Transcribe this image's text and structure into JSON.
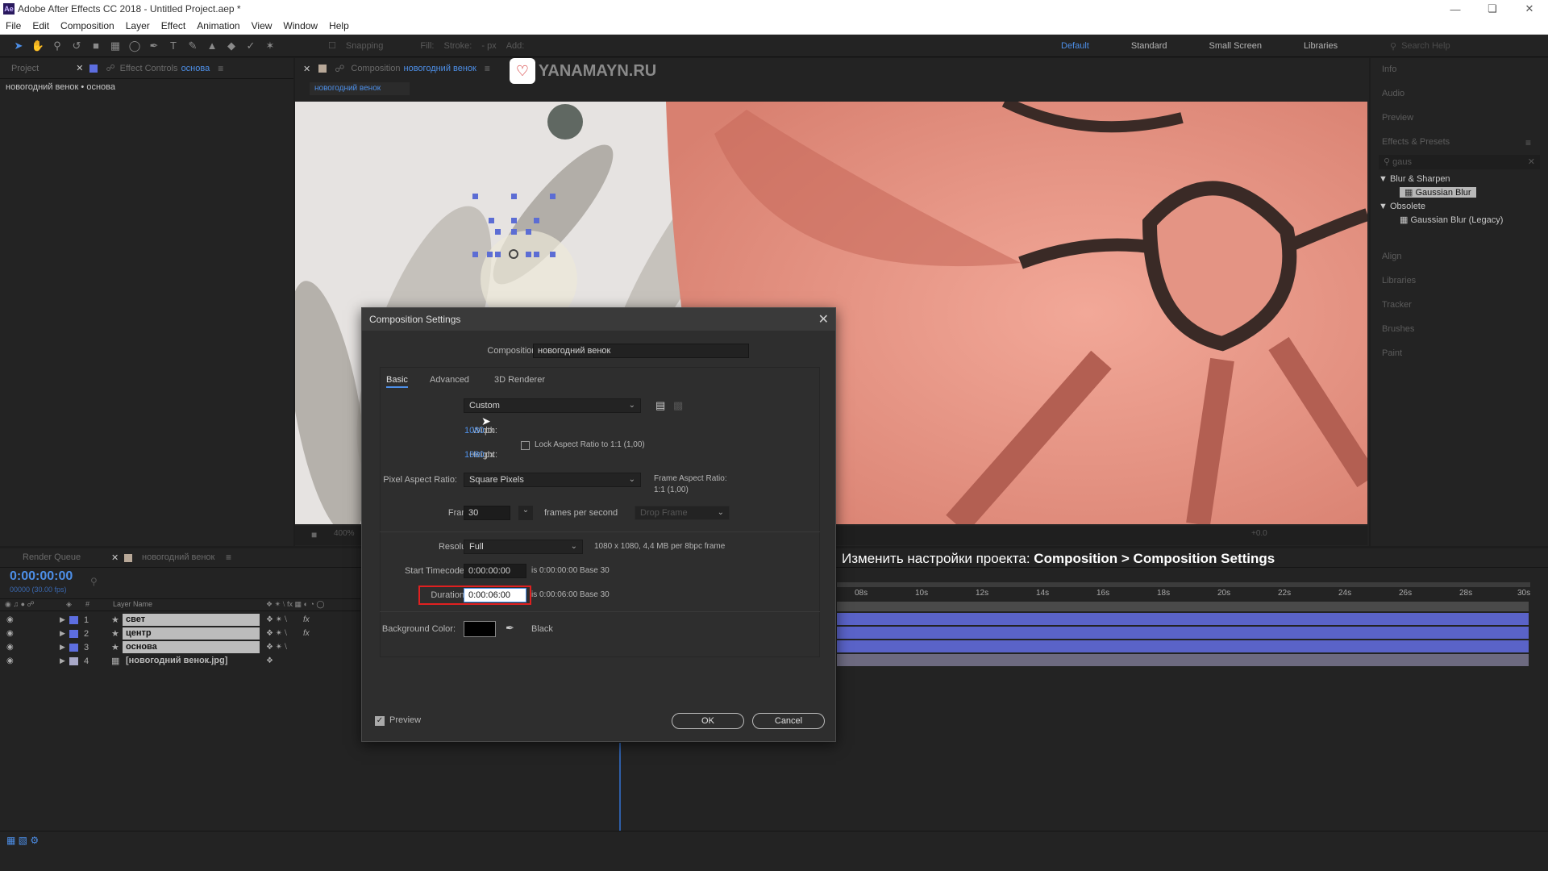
{
  "titlebar": {
    "title": "Adobe After Effects CC 2018 - Untitled Project.aep *",
    "logo": "Ae"
  },
  "menu": [
    "File",
    "Edit",
    "Composition",
    "Layer",
    "Effect",
    "Animation",
    "View",
    "Window",
    "Help"
  ],
  "toolbar": {
    "snapping": "Snapping",
    "fill": "Fill:",
    "stroke": "Stroke:",
    "px": "- px",
    "add": "Add:",
    "workspaces": [
      "Default",
      "Standard",
      "Small Screen",
      "Libraries"
    ],
    "search_help": "Search Help"
  },
  "left_panel": {
    "tab_project": "Project",
    "tab_effect_controls": "Effect Controls",
    "effect_layer": "основа",
    "subtitle": "новогодний венок • основа"
  },
  "comp_panel": {
    "tab_prefix": "Composition",
    "comp_name": "новогодний венок",
    "comp_tab": "новогодний венок",
    "watermark": "YANAMAYN.RU",
    "zoom": "400%",
    "exposure": "+0.0"
  },
  "right_panel": {
    "items": [
      "Info",
      "Audio",
      "Preview",
      "Effects & Presets"
    ],
    "search": "gaus",
    "tree": [
      {
        "label": "Blur & Sharpen",
        "children": [
          "Gaussian Blur"
        ]
      },
      {
        "label": "Obsolete",
        "children": [
          "Gaussian Blur (Legacy)"
        ]
      }
    ],
    "items2": [
      "Align",
      "Libraries",
      "Tracker",
      "Brushes",
      "Paint"
    ]
  },
  "timeline": {
    "tab_render_queue": "Render Queue",
    "tab_comp": "новогодний венок",
    "timecode": "0:00:00:00",
    "fps": "00000 (30.00 fps)",
    "col_layer_name": "Layer Name",
    "col_num": "#",
    "layers": [
      {
        "num": "1",
        "name": "свет",
        "fx": "fx"
      },
      {
        "num": "2",
        "name": "центр",
        "fx": "fx"
      },
      {
        "num": "3",
        "name": "основа",
        "fx": ""
      },
      {
        "num": "4",
        "name": "[новогодний венок.jpg]",
        "fx": ""
      }
    ],
    "ruler": [
      "08s",
      "10s",
      "12s",
      "14s",
      "16s",
      "18s",
      "20s",
      "22s",
      "24s",
      "26s",
      "28s",
      "30s"
    ]
  },
  "caption": {
    "text": "Изменить настройки проекта: ",
    "bold": "Composition > Composition Settings"
  },
  "dialog": {
    "title": "Composition Settings",
    "comp_name_label": "Composition Name:",
    "comp_name_value": "новогодний венок",
    "tabs": [
      "Basic",
      "Advanced",
      "3D Renderer"
    ],
    "preset_label": "Preset:",
    "preset_value": "Custom",
    "width_label": "Width:",
    "width_value": "1080",
    "height_label": "Height:",
    "height_value": "1080",
    "px": "px",
    "lock_aspect": "Lock Aspect Ratio to 1:1 (1,00)",
    "pixel_aspect_label": "Pixel Aspect Ratio:",
    "pixel_aspect_value": "Square Pixels",
    "frame_aspect_label": "Frame Aspect Ratio:",
    "frame_aspect_value": "1:1 (1,00)",
    "frame_rate_label": "Frame Rate:",
    "frame_rate_value": "30",
    "fps_text": "frames per second",
    "drop_frame": "Drop Frame",
    "resolution_label": "Resolution:",
    "resolution_value": "Full",
    "resolution_info": "1080 x 1080, 4,4 MB per 8bpc frame",
    "start_tc_label": "Start Timecode:",
    "start_tc_value": "0:00:00:00",
    "start_tc_info": "is 0:00:00:00  Base 30",
    "duration_label": "Duration:",
    "duration_value": "0:00:06:00",
    "duration_info": "is 0:00:06:00  Base 30",
    "bg_color_label": "Background Color:",
    "bg_color_name": "Black",
    "bg_color": "#000000",
    "preview": "Preview",
    "ok": "OK",
    "cancel": "Cancel"
  },
  "colors": {
    "accent": "#4d8fe8",
    "layer_bar": "#5560c8",
    "duration_highlight": "#e02020"
  }
}
